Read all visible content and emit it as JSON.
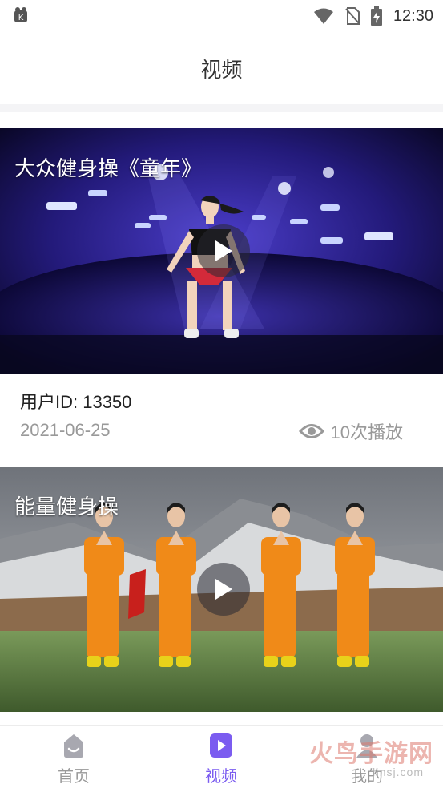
{
  "status_bar": {
    "time": "12:30"
  },
  "header": {
    "title": "视频"
  },
  "videos": [
    {
      "caption": "大众健身操《童年》",
      "user": "用户ID: 13350",
      "date": "2021-06-25",
      "views": "10次播放"
    },
    {
      "caption": "能量健身操"
    }
  ],
  "tabs": [
    {
      "label": "首页",
      "active": false
    },
    {
      "label": "视频",
      "active": true
    },
    {
      "label": "我的",
      "active": false
    }
  ],
  "watermark": {
    "main": "火鸟手游网",
    "sub": "hnsj.com"
  },
  "colors": {
    "accent": "#7b5cf0",
    "inactive": "#999999"
  }
}
